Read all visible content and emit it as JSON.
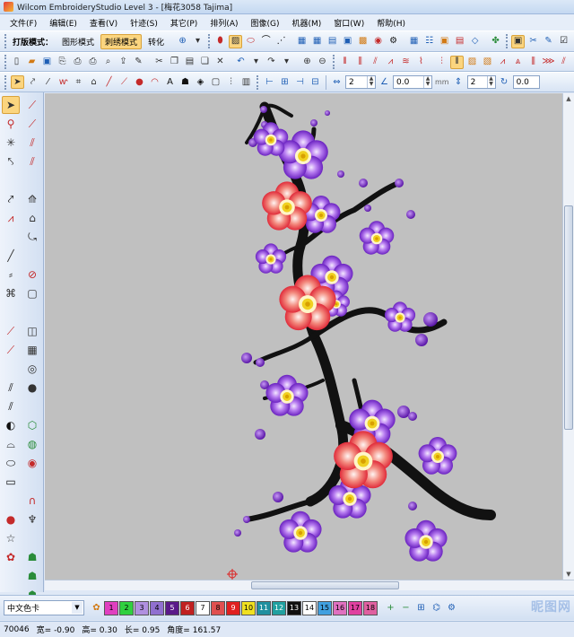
{
  "window": {
    "title": "Wilcom EmbroideryStudio Level 3 - [梅花3058        Tajima]"
  },
  "menu": [
    "文件(F)",
    "编辑(E)",
    "查看(V)",
    "针迹(S)",
    "其它(P)",
    "排列(A)",
    "图像(G)",
    "机器(M)",
    "窗口(W)",
    "帮助(H)"
  ],
  "toolbar1": {
    "mode_label": "打版模式：",
    "tabs": [
      {
        "label": "图形模式",
        "active": false
      },
      {
        "label": "刺绣模式",
        "active": true
      },
      {
        "label": "转化",
        "active": false
      }
    ]
  },
  "toolbar3": {
    "spin_fields": [
      {
        "value": "2"
      },
      {
        "value": "0.0"
      },
      {
        "value": "2"
      },
      {
        "value": "0.0"
      }
    ],
    "unit": "mm"
  },
  "color_bar": {
    "palette": "中文色卡",
    "swatches": [
      {
        "num": "1",
        "color": "#e040c0"
      },
      {
        "num": "2",
        "color": "#30d040"
      },
      {
        "num": "3",
        "color": "#b090e0"
      },
      {
        "num": "4",
        "color": "#9070d0"
      },
      {
        "num": "5",
        "color": "#5a1a8a"
      },
      {
        "num": "6",
        "color": "#c02020"
      },
      {
        "num": "7",
        "color": "#ffffff"
      },
      {
        "num": "8",
        "color": "#e05050"
      },
      {
        "num": "9",
        "color": "#e02020"
      },
      {
        "num": "10",
        "color": "#f0e020"
      },
      {
        "num": "11",
        "color": "#2090a0"
      },
      {
        "num": "12",
        "color": "#20a0a0"
      },
      {
        "num": "13",
        "color": "#101010"
      },
      {
        "num": "14",
        "color": "#ffffff"
      },
      {
        "num": "15",
        "color": "#40a0e0"
      },
      {
        "num": "16",
        "color": "#e070c0"
      },
      {
        "num": "17",
        "color": "#e040a0"
      },
      {
        "num": "18",
        "color": "#e060a0"
      }
    ],
    "watermark": "昵图网"
  },
  "status": {
    "stitches": "70046",
    "width_label": "宽=",
    "width": "-0.90",
    "height_label": "高=",
    "height": "0.30",
    "length_label": "长=",
    "length": "0.95",
    "angle_label": "角度=",
    "angle": "161.57"
  },
  "colors": {
    "accent": "#fbd57f",
    "canvas_bg": "#c0c0c0",
    "petal_purple": "#8a3fd6",
    "petal_red": "#e84848",
    "branch": "#111111"
  }
}
